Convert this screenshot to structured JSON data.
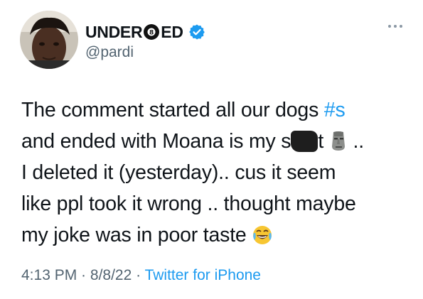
{
  "author": {
    "name_part1": "UNDER",
    "name_part2": "ED",
    "handle": "@pardi",
    "verified": true
  },
  "tweet": {
    "line1_text": "The comment started all our dogs ",
    "line1_hashtag": "#s",
    "line2_before": "and ended with Moana is my s",
    "line2_after": "t",
    "line2_end": " ..",
    "line3": "I deleted it (yesterday).. cus it seem",
    "line4": "like ppl took it wrong .. thought maybe",
    "line5": "my joke was in poor taste"
  },
  "meta": {
    "time": "4:13 PM",
    "sep1": " · ",
    "date": "8/8/22",
    "sep2": " · ",
    "source": "Twitter for iPhone"
  },
  "colors": {
    "accent": "#1d9bf0",
    "secondary_text": "#536471",
    "primary_text": "#0f1419"
  },
  "icons": [
    "eight-ball-icon",
    "verified-badge-icon",
    "more-options-icon",
    "moai-emoji-icon",
    "tears-of-joy-emoji-icon"
  ]
}
